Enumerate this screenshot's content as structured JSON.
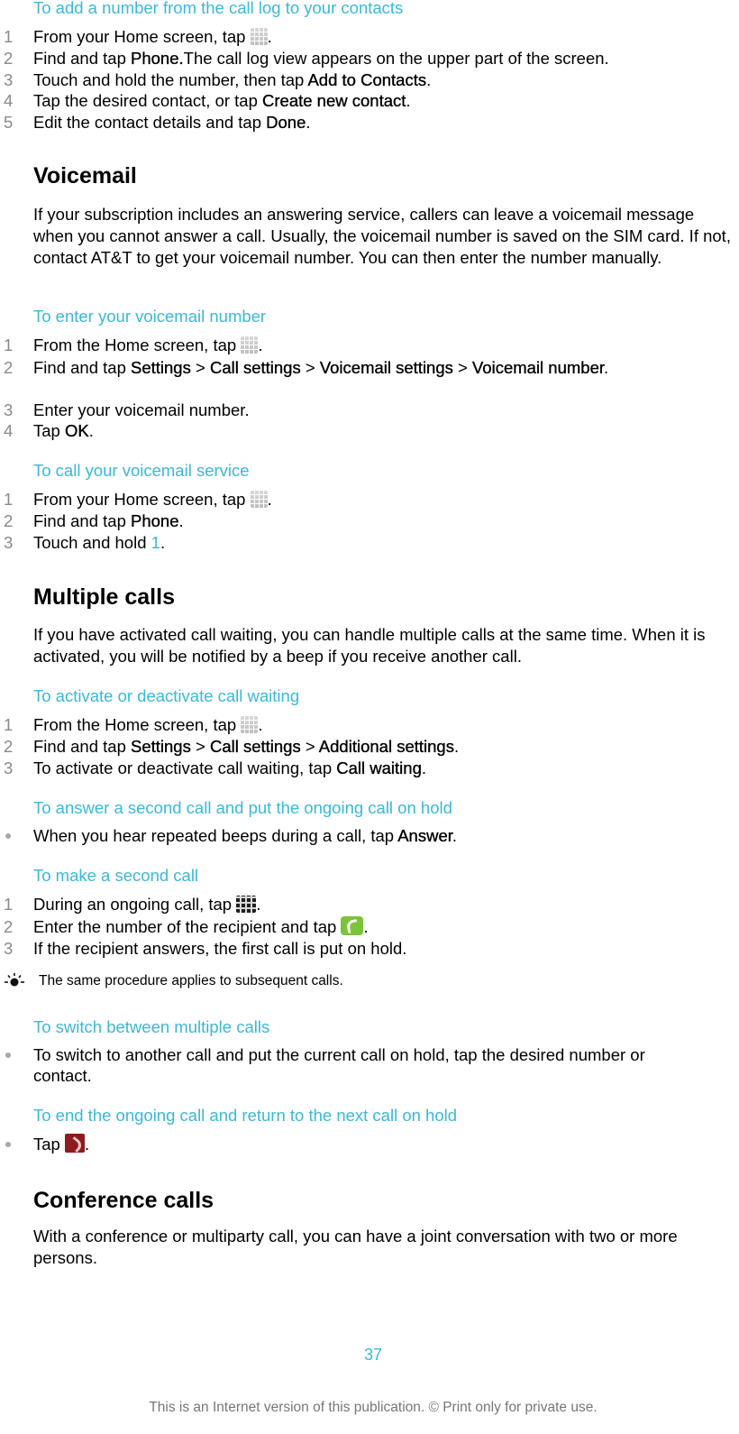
{
  "sections": {
    "add_number": {
      "subhead": "To add a number from the call log to your contacts",
      "steps": [
        {
          "num": "1",
          "pre": "From your Home screen, tap ",
          "icon": "apps-grid-icon",
          "post": "."
        },
        {
          "num": "2",
          "pre": "Find and tap ",
          "bold": "Phone.",
          "post": "The call log view appears on the upper part of the screen."
        },
        {
          "num": "3",
          "pre": "Touch and hold the number, then tap ",
          "bold": "Add to Contacts",
          "post": "."
        },
        {
          "num": "4",
          "pre": "Tap the desired contact, or tap ",
          "bold": "Create new contact",
          "post": "."
        },
        {
          "num": "5",
          "pre": "Edit the contact details and tap ",
          "bold": "Done",
          "post": "."
        }
      ]
    },
    "voicemail": {
      "heading": "Voicemail",
      "para": "If your subscription includes an answering service, callers can leave a voicemail message when you cannot answer a call. Usually, the voicemail number is saved on the SIM card. If not, contact AT&T to get your voicemail number. You can then enter the number manually."
    },
    "enter_voicemail": {
      "subhead": "To enter your voicemail number",
      "steps": [
        {
          "num": "1",
          "pre": "From the Home screen, tap ",
          "post": "."
        },
        {
          "num": "2",
          "pre": "Find and tap ",
          "b1": "Settings",
          "sep1": " > ",
          "b2": "Call settings",
          "sep2": " > ",
          "b3": "Voicemail settings",
          "sep3": " > ",
          "b4": "Voicemail number",
          "post": "."
        },
        {
          "num": "3",
          "pre": "Enter your voicemail number."
        },
        {
          "num": "4",
          "pre": "Tap ",
          "bold": "OK",
          "post": "."
        }
      ]
    },
    "call_voicemail": {
      "subhead": "To call your voicemail service",
      "steps": [
        {
          "num": "1",
          "pre": "From your Home screen, tap ",
          "post": "."
        },
        {
          "num": "2",
          "pre": "Find and tap ",
          "bold": "Phone",
          "post": "."
        },
        {
          "num": "3",
          "pre": "Touch and hold ",
          "key": "1",
          "post": "."
        }
      ]
    },
    "multiple_calls": {
      "heading": "Multiple calls",
      "para": "If you have activated call waiting, you can handle multiple calls at the same time. When it is activated, you will be notified by a beep if you receive another call."
    },
    "call_waiting": {
      "subhead": "To activate or deactivate call waiting",
      "steps": [
        {
          "num": "1",
          "pre": "From the Home screen, tap ",
          "post": "."
        },
        {
          "num": "2",
          "pre": "Find and tap ",
          "b1": "Settings",
          "sep1": " > ",
          "b2": "Call settings",
          "sep2": " > ",
          "b3": "Additional settings",
          "post": "."
        },
        {
          "num": "3",
          "pre": "To activate or deactivate call waiting, tap ",
          "bold": "Call waiting",
          "post": "."
        }
      ]
    },
    "answer_second": {
      "subhead": "To answer a second call and put the ongoing call on hold",
      "bullets": [
        {
          "pre": "When you hear repeated beeps during a call, tap ",
          "bold": "Answer",
          "post": "."
        }
      ]
    },
    "make_second": {
      "subhead": "To make a second call",
      "steps": [
        {
          "num": "1",
          "pre": "During an ongoing call, tap ",
          "post": "."
        },
        {
          "num": "2",
          "pre": "Enter the number of the recipient and tap ",
          "post": "."
        },
        {
          "num": "3",
          "pre": "If the recipient answers, the first call is put on hold."
        }
      ],
      "tip": "The same procedure applies to subsequent calls."
    },
    "switch_calls": {
      "subhead": "To switch between multiple calls",
      "bullets": [
        {
          "pre": "To switch to another call and put the current call on hold, tap the desired number or contact."
        }
      ]
    },
    "end_call": {
      "subhead": "To end the ongoing call and return to the next call on hold",
      "bullets": [
        {
          "pre": "Tap ",
          "post": "."
        }
      ]
    },
    "conference": {
      "heading": "Conference calls",
      "para": "With a conference or multiparty call, you can have a joint conversation with two or more persons."
    }
  },
  "footer": {
    "page_number": "37",
    "notice": "This is an Internet version of this publication. © Print only for private use."
  },
  "colors": {
    "accent": "#3ab8d9",
    "step_number": "#8a8a8a",
    "call_button": "#7cc33b",
    "end_call_button": "#8e1b1f"
  }
}
